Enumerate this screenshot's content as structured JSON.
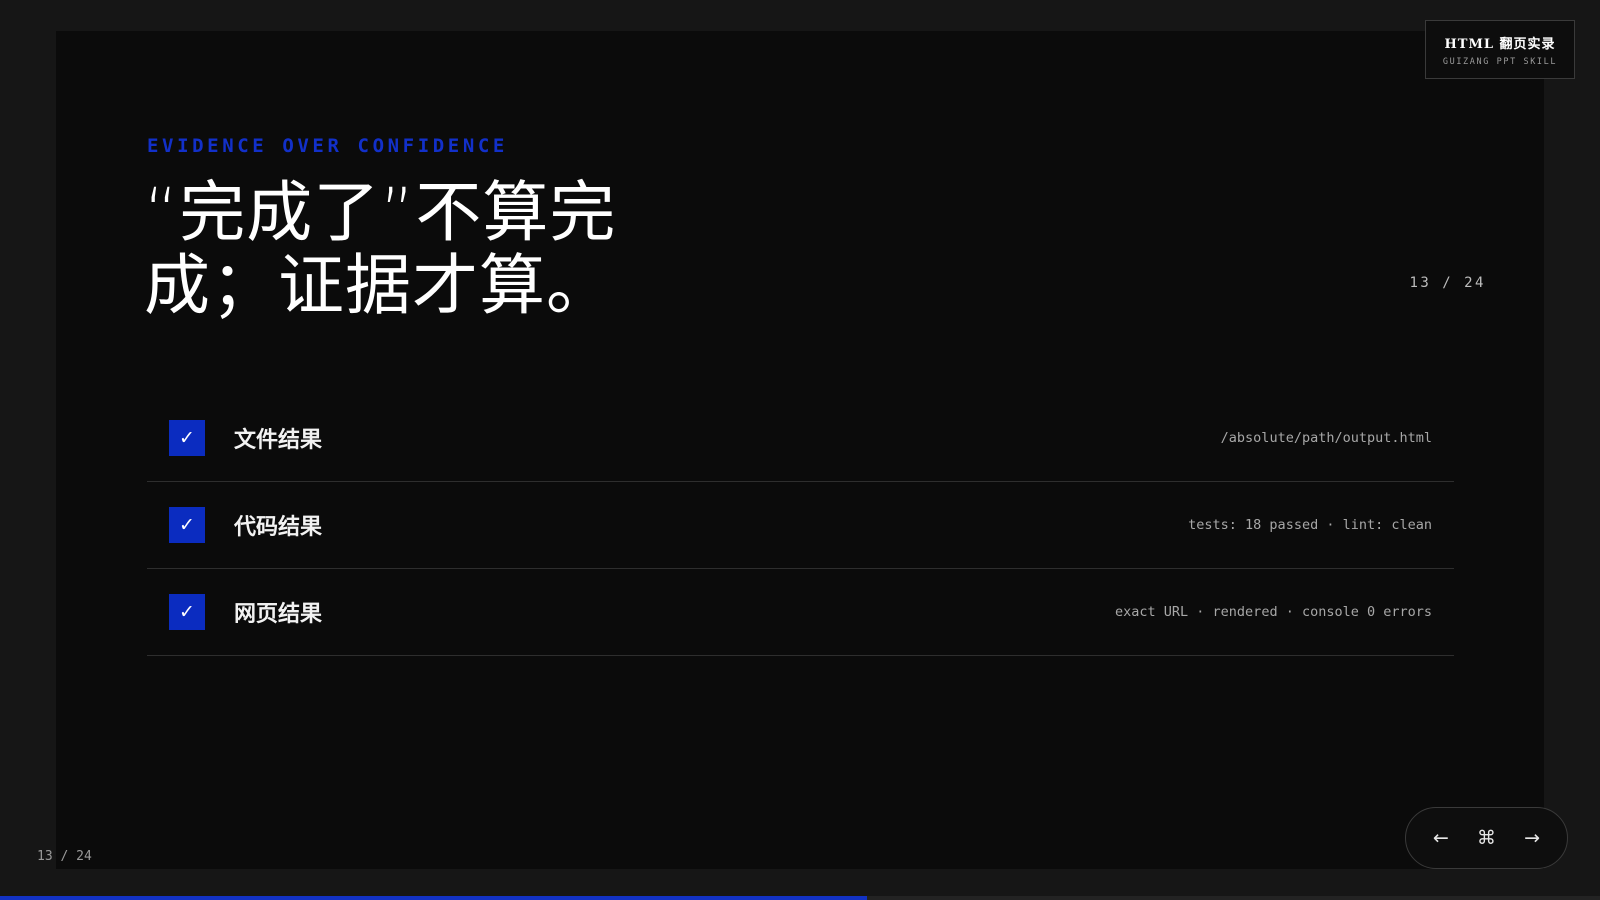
{
  "slide": {
    "eyebrow": "EVIDENCE OVER CONFIDENCE",
    "headline": "“完成了”不算完成；证据才算。",
    "counter": "13 / 24"
  },
  "checklist": [
    {
      "label": "文件结果",
      "detail": "/absolute/path/output.html",
      "checked": true
    },
    {
      "label": "代码结果",
      "detail": "tests: 18 passed · lint: clean",
      "checked": true
    },
    {
      "label": "网页结果",
      "detail": "exact URL · rendered · console 0 errors",
      "checked": true
    }
  ],
  "check_glyph": "✓",
  "brand": {
    "title": "HTML 翻页实录",
    "subtitle": "GUIZANG PPT SKILL"
  },
  "footer_counter": "13 / 24",
  "nav": {
    "prev": "←",
    "command": "⌘",
    "next": "→"
  },
  "progress": {
    "current": 13,
    "total": 24,
    "fraction": 0.5417
  },
  "colors": {
    "accent": "#0b2cc0",
    "eyebrow": "#1230c9",
    "background": "#0b0b0b"
  }
}
